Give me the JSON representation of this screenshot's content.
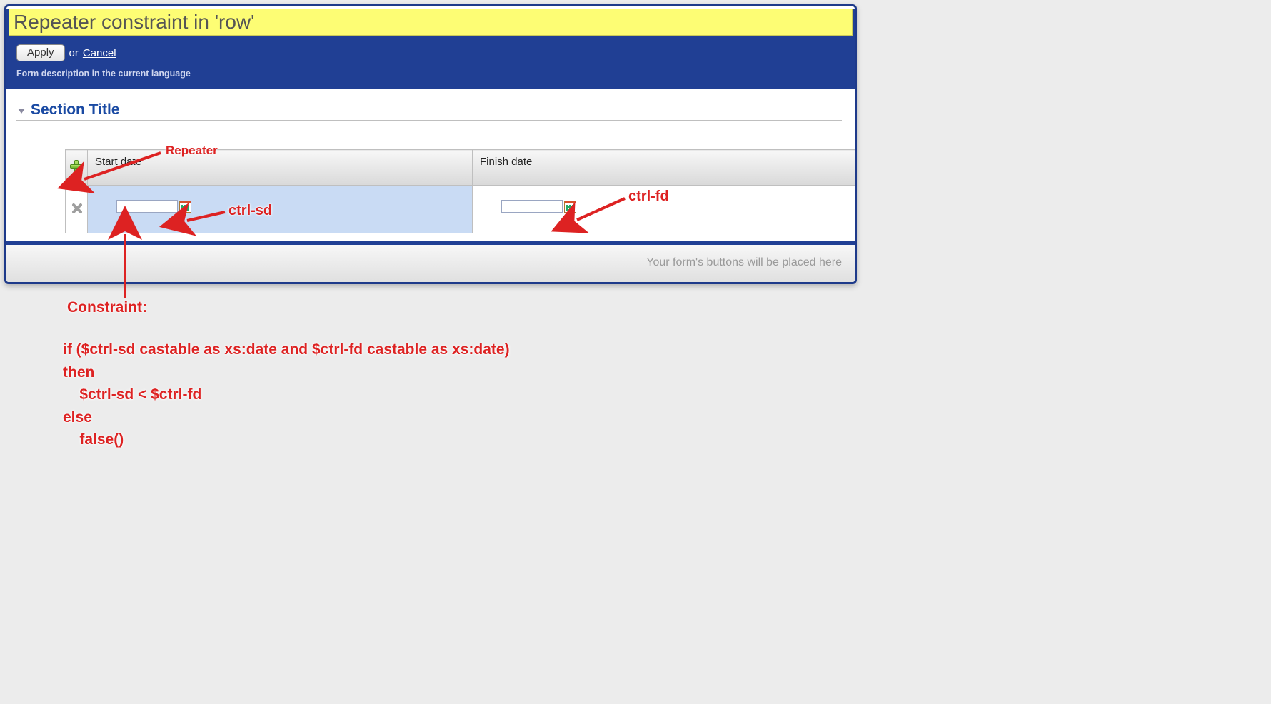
{
  "header": {
    "title": "Repeater constraint in 'row'",
    "apply_label": "Apply",
    "or_label": "or",
    "cancel_label": "Cancel",
    "description": "Form description in the current language"
  },
  "section": {
    "title": "Section Title",
    "columns": {
      "start": "Start date",
      "finish": "Finish date"
    },
    "row": {
      "start_value": "",
      "finish_value": ""
    }
  },
  "footer": {
    "placeholder": "Your form's buttons will be placed here"
  },
  "annotations": {
    "repeater_label": "Repeater",
    "ctrl_sd": "ctrl-sd",
    "ctrl_fd": "ctrl-fd",
    "constraint_label": "Constraint:",
    "constraint_code": "if ($ctrl-sd castable as xs:date and $ctrl-fd castable as xs:date)\nthen\n    $ctrl-sd < $ctrl-fd\nelse\n    false()"
  }
}
